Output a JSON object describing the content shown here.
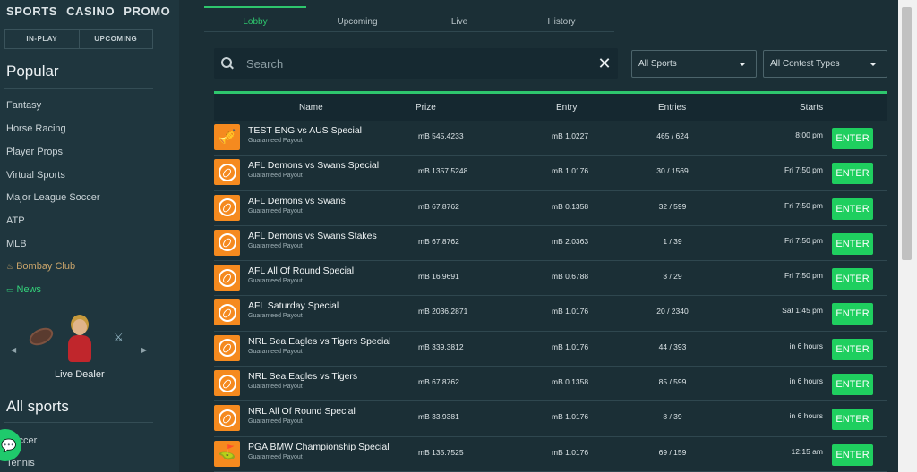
{
  "topnav": [
    "SPORTS",
    "CASINO",
    "PROMO"
  ],
  "segment": [
    "IN-PLAY",
    "UPCOMING"
  ],
  "sidebar": {
    "popular_heading": "Popular",
    "popular_items": [
      "Fantasy",
      "Horse Racing",
      "Player Props",
      "Virtual Sports",
      "Major League Soccer",
      "ATP",
      "MLB"
    ],
    "bombay_label": "Bombay Club",
    "news_label": "News",
    "carousel_label": "Live Dealer",
    "all_sports_heading": "All sports",
    "all_sports_items": [
      "Soccer",
      "Tennis"
    ]
  },
  "tabs": [
    "Lobby",
    "Upcoming",
    "Live",
    "History"
  ],
  "search": {
    "placeholder": "Search"
  },
  "filters": {
    "sports": "All Sports",
    "contest": "All Contest Types"
  },
  "table": {
    "headers": {
      "name": "Name",
      "prize": "Prize",
      "entry": "Entry",
      "entries": "Entries",
      "starts": "Starts"
    },
    "enter_label": "ENTER",
    "rows": [
      {
        "icon": "whistle",
        "name": "TEST ENG vs AUS Special",
        "sub": "Guaranteed Payout",
        "prize": "mB 545.4233",
        "entry": "mB 1.0227",
        "entries": "465 / 624",
        "starts": "8:00 pm"
      },
      {
        "icon": "football",
        "name": "AFL Demons vs Swans Special",
        "sub": "Guaranteed Payout",
        "prize": "mB 1357.5248",
        "entry": "mB 1.0176",
        "entries": "30 / 1569",
        "starts": "Fri 7:50 pm"
      },
      {
        "icon": "football",
        "name": "AFL Demons vs Swans",
        "sub": "Guaranteed Payout",
        "prize": "mB 67.8762",
        "entry": "mB 0.1358",
        "entries": "32 / 599",
        "starts": "Fri 7:50 pm"
      },
      {
        "icon": "football",
        "name": "AFL Demons vs Swans Stakes",
        "sub": "Guaranteed Payout",
        "prize": "mB 67.8762",
        "entry": "mB 2.0363",
        "entries": "1 / 39",
        "starts": "Fri 7:50 pm"
      },
      {
        "icon": "football",
        "name": "AFL All Of Round Special",
        "sub": "Guaranteed Payout",
        "prize": "mB 16.9691",
        "entry": "mB 0.6788",
        "entries": "3 / 29",
        "starts": "Fri 7:50 pm"
      },
      {
        "icon": "football",
        "name": "AFL Saturday Special",
        "sub": "Guaranteed Payout",
        "prize": "mB 2036.2871",
        "entry": "mB 1.0176",
        "entries": "20 / 2340",
        "starts": "Sat 1:45 pm"
      },
      {
        "icon": "football",
        "name": "NRL Sea Eagles vs Tigers Special",
        "sub": "Guaranteed Payout",
        "prize": "mB 339.3812",
        "entry": "mB 1.0176",
        "entries": "44 / 393",
        "starts": "in 6 hours"
      },
      {
        "icon": "football",
        "name": "NRL Sea Eagles vs Tigers",
        "sub": "Guaranteed Payout",
        "prize": "mB 67.8762",
        "entry": "mB 0.1358",
        "entries": "85 / 599",
        "starts": "in 6 hours"
      },
      {
        "icon": "football",
        "name": "NRL All Of Round Special",
        "sub": "Guaranteed Payout",
        "prize": "mB 33.9381",
        "entry": "mB 1.0176",
        "entries": "8 / 39",
        "starts": "in 6 hours"
      },
      {
        "icon": "golf",
        "name": "PGA BMW Championship Special",
        "sub": "Guaranteed Payout",
        "prize": "mB 135.7525",
        "entry": "mB 1.0176",
        "entries": "69 / 159",
        "starts": "12:15 am"
      }
    ]
  },
  "colors": {
    "accent": "#2ec66d",
    "enter": "#1fcf5f",
    "icon_bg": "#f58a1f",
    "bg": "#1b2f36",
    "sidebar_bg": "#1f363e"
  }
}
